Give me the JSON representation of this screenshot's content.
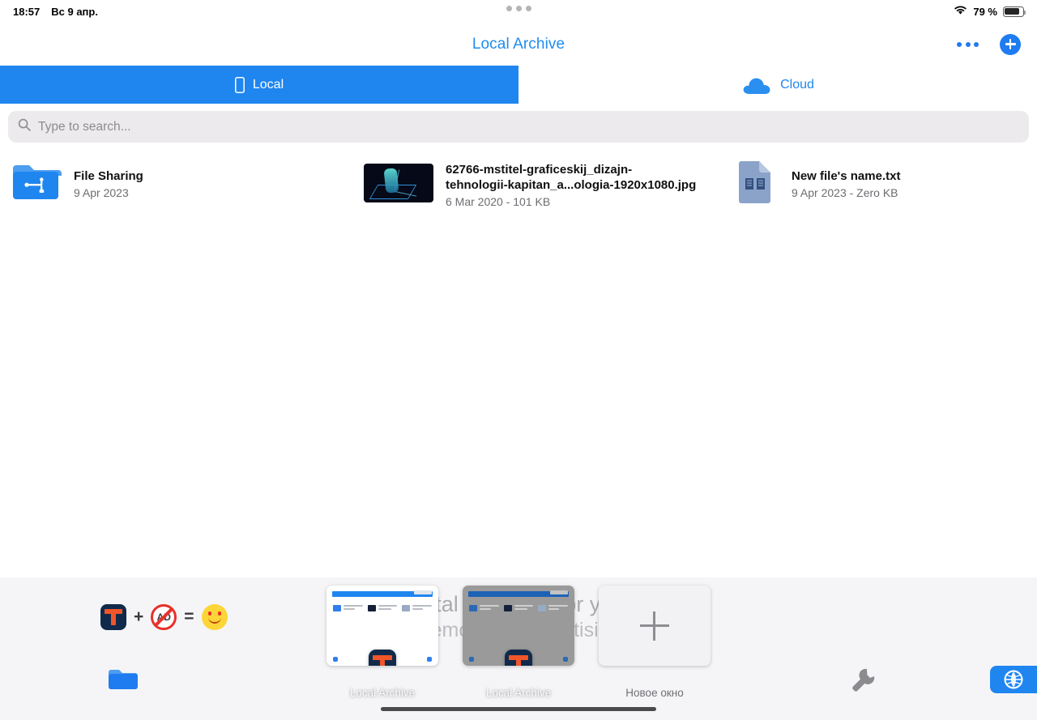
{
  "status_bar": {
    "time": "18:57",
    "date": "Вс 9 апр.",
    "wifi_icon": "wifi-icon",
    "battery_percent": "79 %",
    "multitask_handle": "multitask-handle"
  },
  "nav": {
    "title": "Local Archive",
    "more_icon": "more-dots-icon",
    "add_icon": "add-plus-icon"
  },
  "tabs": [
    {
      "label": "Local",
      "icon": "device-icon",
      "active": true
    },
    {
      "label": "Cloud",
      "icon": "cloud-icon",
      "active": false
    }
  ],
  "search": {
    "placeholder": "Type to search...",
    "value": "",
    "icon": "search-icon"
  },
  "files": [
    {
      "name": "File Sharing",
      "meta": "9 Apr 2023",
      "icon": "usb-folder-icon",
      "kind": "folder"
    },
    {
      "name": "62766-mstitel-graficeskij_dizajn-tehnologii-kapitan_a...ologia-1920x1080.jpg",
      "name_line1": "62766-mstitel-graficeskij_dizajn-",
      "name_line2": "tehnologii-kapitan_a...ologia-1920x1080.jpg",
      "meta": "6 Mar 2020 - 101 KB",
      "icon": "image-thumbnail",
      "kind": "image"
    },
    {
      "name": "New file's name.txt",
      "meta": "9 Apr 2023 - Zero KB",
      "icon": "text-document-icon",
      "kind": "document"
    }
  ],
  "promo": {
    "line1": "Total Ads Free for you",
    "line2": "Remove all advertising",
    "formula": {
      "app_icon": "total-app-icon",
      "plus": "+",
      "no_ads_icon": "no-ads-icon",
      "no_ads_label": "AD",
      "equals": "=",
      "smiley_icon": "smiley-icon"
    }
  },
  "window_switcher": {
    "cards": [
      {
        "label": "Local Archive",
        "state": "active",
        "badge_icon": "total-app-icon"
      },
      {
        "label": "Local Archive",
        "state": "dimmed",
        "badge_icon": "total-app-icon"
      },
      {
        "label": "Новое окно",
        "state": "new",
        "icon": "plus-icon"
      }
    ]
  },
  "dock": {
    "folder_icon": "folder-icon",
    "wrench_icon": "wrench-icon",
    "browser_icon": "globe-icon"
  },
  "home_indicator": "home-indicator",
  "colors": {
    "accent_blue": "#1f86f0",
    "title_blue": "#1f8cf0",
    "search_bg": "#eceaec",
    "muted_text": "#6d6d72"
  }
}
